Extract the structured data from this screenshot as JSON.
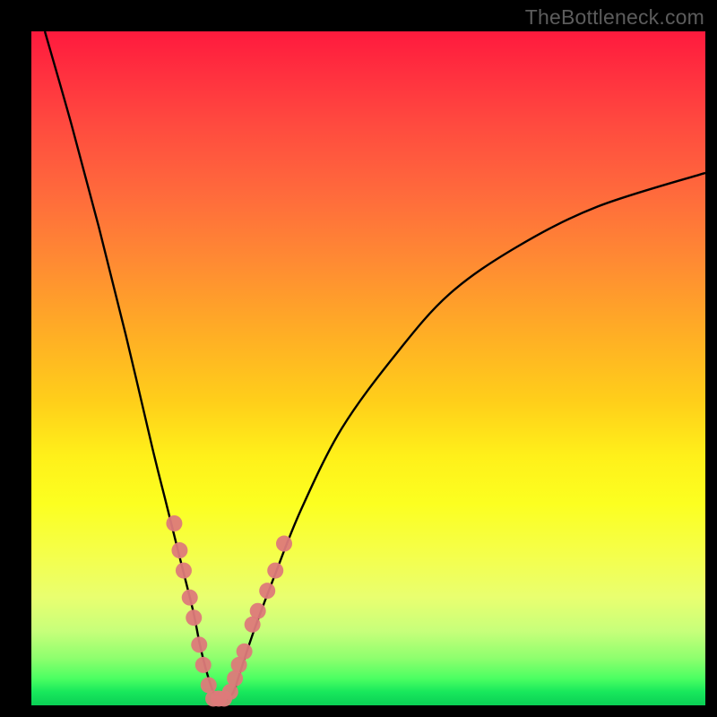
{
  "watermark": "TheBottleneck.com",
  "chart_data": {
    "type": "line",
    "title": "",
    "xlabel": "",
    "ylabel": "",
    "xlim": [
      0,
      100
    ],
    "ylim": [
      0,
      100
    ],
    "grid": false,
    "legend": false,
    "notes": "V-shaped bottleneck curve on red→yellow→green gradient; minimum band highlighted with pink markers",
    "series": [
      {
        "name": "bottleneck-curve",
        "x": [
          2,
          6,
          10,
          14,
          18,
          20,
          22,
          24,
          25,
          26,
          27,
          28,
          29,
          30,
          31,
          33,
          36,
          40,
          46,
          54,
          62,
          72,
          84,
          100
        ],
        "y": [
          100,
          86,
          71,
          55,
          38,
          30,
          22,
          14,
          9,
          5,
          2,
          1,
          1,
          2,
          5,
          11,
          19,
          29,
          41,
          52,
          61,
          68,
          74,
          79
        ]
      }
    ],
    "markers": {
      "name": "optimum-band",
      "x": [
        21.2,
        22.0,
        22.6,
        23.5,
        24.1,
        24.9,
        25.5,
        26.3,
        27.0,
        27.8,
        28.6,
        29.5,
        30.2,
        30.8,
        31.6,
        32.8,
        33.6,
        35.0,
        36.2,
        37.5
      ],
      "y": [
        27,
        23,
        20,
        16,
        13,
        9,
        6,
        3,
        1,
        1,
        1,
        2,
        4,
        6,
        8,
        12,
        14,
        17,
        20,
        24
      ]
    }
  }
}
